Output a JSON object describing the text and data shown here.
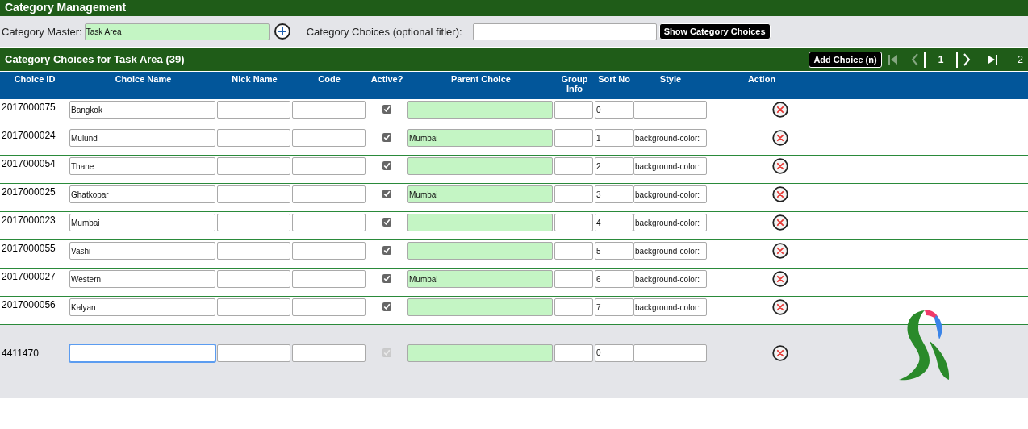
{
  "title": "Category Management",
  "filter": {
    "master_label": "Category Master:",
    "master_value": "Task Area",
    "choices_label": "Category Choices (optional fitler):",
    "show_button": "Show Category Choices"
  },
  "section": {
    "title": "Category Choices for Task Area (39)",
    "add_button": "Add Choice (n)"
  },
  "pager": {
    "first_disabled": true,
    "prev_disabled": true,
    "current": "1",
    "last_page": "2"
  },
  "columns": [
    "Choice ID",
    "Choice Name",
    "Nick Name",
    "Code",
    "Active?",
    "Parent Choice",
    "Group Info",
    "Sort No",
    "Style",
    "Action"
  ],
  "rows": [
    {
      "id": "2017000075",
      "name": "Bangkok",
      "active": true,
      "sort": "0"
    },
    {
      "id": "2017000024",
      "name": "Mulund",
      "active": true,
      "parent": "Mumbai",
      "sort": "1",
      "style": "background-color:"
    },
    {
      "id": "2017000054",
      "name": "Thane",
      "active": true,
      "sort": "2",
      "style": "background-color:"
    },
    {
      "id": "2017000025",
      "name": "Ghatkopar",
      "active": true,
      "parent": "Mumbai",
      "sort": "3",
      "style": "background-color:"
    },
    {
      "id": "2017000023",
      "name": "Mumbai",
      "active": true,
      "sort": "4",
      "style": "background-color:"
    },
    {
      "id": "2017000055",
      "name": "Vashi",
      "active": true,
      "sort": "5",
      "style": "background-color:"
    },
    {
      "id": "2017000027",
      "name": "Western",
      "active": true,
      "parent": "Mumbai",
      "sort": "6",
      "style": "background-color:"
    },
    {
      "id": "2017000056",
      "name": "Kalyan",
      "active": true,
      "sort": "7",
      "style": "background-color:"
    }
  ],
  "new_row": {
    "id": "4411470",
    "name_focused": true,
    "active": true,
    "active_disabled": true,
    "sort": "0"
  }
}
